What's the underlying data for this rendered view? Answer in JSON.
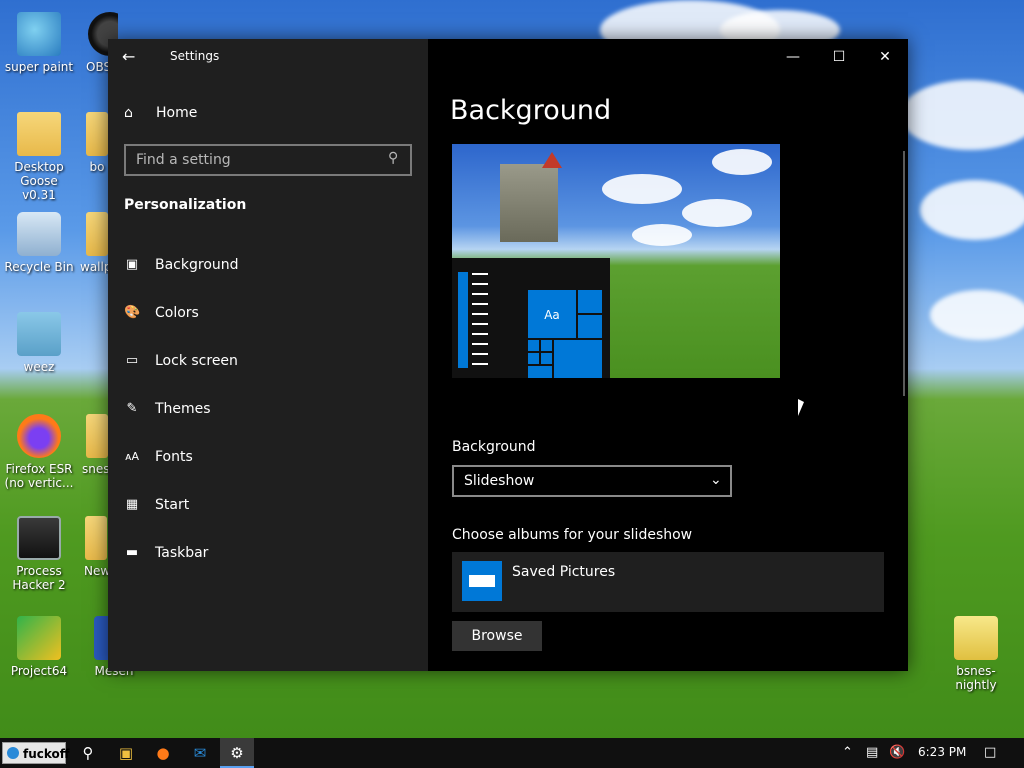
{
  "desktop": {
    "icons": [
      {
        "name": "desk-icon-super-paint",
        "label": "super paint"
      },
      {
        "name": "desk-icon-obs",
        "label": "OBS"
      },
      {
        "name": "desk-icon-desktop-goose",
        "label": "Desktop Goose v0.31"
      },
      {
        "name": "desk-icon-bo",
        "label": "bo"
      },
      {
        "name": "desk-icon-recycle-bin",
        "label": "Recycle Bin"
      },
      {
        "name": "desk-icon-wallp",
        "label": "wallp"
      },
      {
        "name": "desk-icon-weez",
        "label": "weez"
      },
      {
        "name": "desk-icon-firefox",
        "label": "Firefox ESR (no vertic..."
      },
      {
        "name": "desk-icon-snes",
        "label": "snes"
      },
      {
        "name": "desk-icon-process-hacker",
        "label": "Process Hacker 2"
      },
      {
        "name": "desk-icon-new",
        "label": "New"
      },
      {
        "name": "desk-icon-project64",
        "label": "Project64"
      },
      {
        "name": "desk-icon-mesen",
        "label": "Mesen"
      },
      {
        "name": "desk-icon-bsnes",
        "label": "bsnes-nightly"
      }
    ]
  },
  "window": {
    "title": "Settings",
    "controls": {
      "minimize": "—",
      "maximize": "☐",
      "close": "✕"
    }
  },
  "sidebar": {
    "home": "Home",
    "search_placeholder": "Find a setting",
    "section": "Personalization",
    "items": [
      {
        "label": "Background",
        "icon": "image-icon"
      },
      {
        "label": "Colors",
        "icon": "palette-icon"
      },
      {
        "label": "Lock screen",
        "icon": "lock-screen-icon"
      },
      {
        "label": "Themes",
        "icon": "themes-icon"
      },
      {
        "label": "Fonts",
        "icon": "fonts-icon"
      },
      {
        "label": "Start",
        "icon": "start-icon"
      },
      {
        "label": "Taskbar",
        "icon": "taskbar-icon"
      }
    ]
  },
  "main": {
    "heading": "Background",
    "preview_tile_text": "Aa",
    "background_label": "Background",
    "background_value": "Slideshow",
    "albums_label": "Choose albums for your slideshow",
    "album_name": "Saved Pictures",
    "browse": "Browse"
  },
  "taskbar": {
    "start_label": "fuckoff",
    "clock": "6:23 PM"
  },
  "colors": {
    "accent": "#0078d7",
    "sidebar": "#1f1f1f",
    "main": "#000000"
  }
}
